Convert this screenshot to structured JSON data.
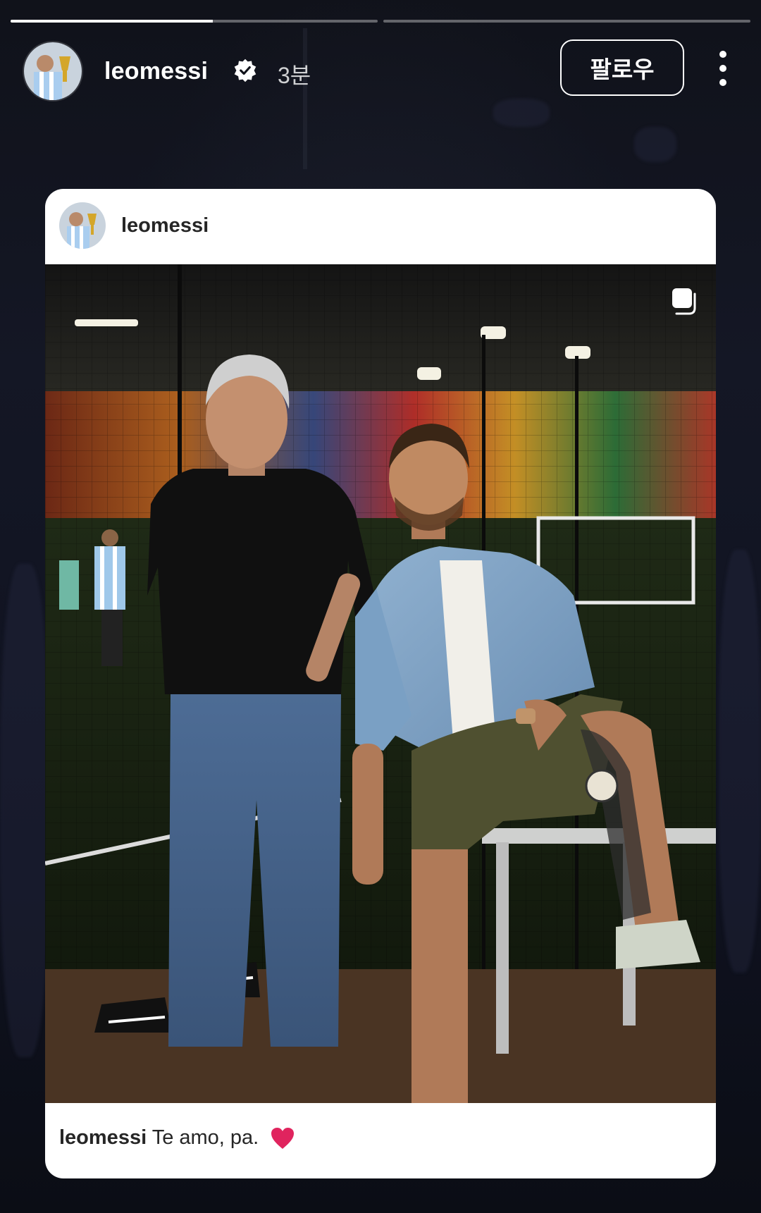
{
  "story": {
    "progress_segments": [
      0.55,
      0
    ],
    "username": "leomessi",
    "time_ago": "3분",
    "follow_label": "팔로우",
    "icons": {
      "verified": "verified-badge-icon",
      "more": "more-options-icon",
      "multi": "carousel-icon",
      "heart": "red-heart-icon"
    }
  },
  "post": {
    "username": "leomessi",
    "caption_user": "leomessi",
    "caption_text": "Te amo, pa.",
    "emoji": "❤️"
  },
  "colors": {
    "background": "#0c0e16",
    "card": "#ffffff",
    "text_dark": "#262626",
    "heart": "#e0245e",
    "verified": "#ffffff"
  }
}
